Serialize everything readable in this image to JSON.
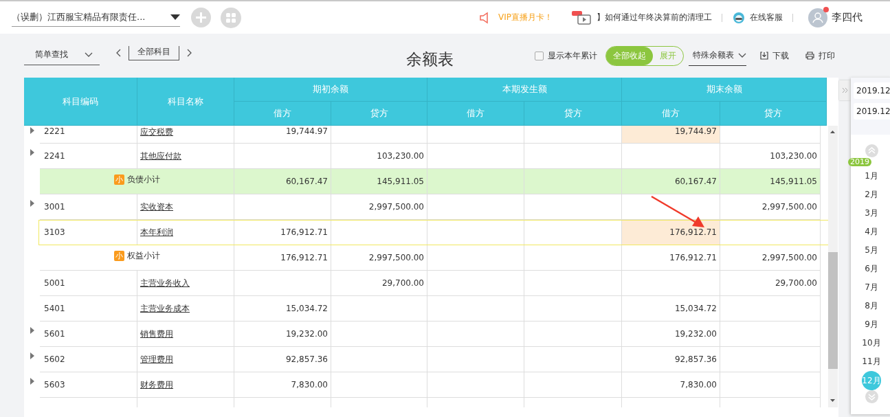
{
  "top_bar": {
    "company": "（误删）江西服宝精品有限责任...",
    "promo": "VIP直播月卡！",
    "news": "】如何通过年终决算前的清理工",
    "support": "在线客服",
    "user": "李四代",
    "user_notification": true
  },
  "toolbar": {
    "search_mode": "简单查找",
    "scope": "全部科目",
    "title": "余额表",
    "cumulative": {
      "label": "显示本年累计",
      "checked": false
    },
    "toggle": [
      {
        "label": "全部收起",
        "selected": true
      },
      {
        "label": "展开",
        "selected": false
      }
    ],
    "report_type": "特殊余额表",
    "download": "下载",
    "print": "打印"
  },
  "table": {
    "columns": [
      {
        "label": "科目编码"
      },
      {
        "label": "科目名称"
      }
    ],
    "groups": [
      {
        "label": "期初余额",
        "columns": [
          "借方",
          "贷方"
        ]
      },
      {
        "label": "本期发生额",
        "columns": [
          "借方",
          "贷方"
        ]
      },
      {
        "label": "期末余额",
        "columns": [
          "借方",
          "贷方"
        ]
      }
    ],
    "rows": [
      {
        "kind": "account",
        "code": "2221",
        "name": "应交税费",
        "expandable": true,
        "selected": false,
        "flagged": true,
        "values": {
          "opening_debit": "19,744.97",
          "closing_debit": "19,744.97"
        }
      },
      {
        "kind": "account",
        "code": "2241",
        "name": "其他应付款",
        "expandable": true,
        "selected": false,
        "flagged": false,
        "values": {
          "opening_credit": "103,230.00",
          "closing_credit": "103,230.00"
        }
      },
      {
        "kind": "subtotal",
        "name": "负债小计",
        "highlighted": true,
        "badge": "小",
        "values": {
          "opening_debit": "60,167.47",
          "opening_credit": "145,911.05",
          "closing_debit": "60,167.47",
          "closing_credit": "145,911.05"
        }
      },
      {
        "kind": "account",
        "code": "3001",
        "name": "实收资本",
        "expandable": true,
        "selected": false,
        "flagged": false,
        "values": {
          "opening_credit": "2,997,500.00",
          "closing_credit": "2,997,500.00"
        }
      },
      {
        "kind": "account",
        "code": "3103",
        "name": "本年利润",
        "expandable": false,
        "selected": true,
        "flagged": true,
        "values": {
          "opening_debit": "176,912.71",
          "closing_debit": "176,912.71"
        }
      },
      {
        "kind": "subtotal",
        "name": "权益小计",
        "highlighted": false,
        "badge": "小",
        "values": {
          "opening_debit": "176,912.71",
          "opening_credit": "2,997,500.00",
          "closing_debit": "176,912.71",
          "closing_credit": "2,997,500.00"
        }
      },
      {
        "kind": "account",
        "code": "5001",
        "name": "主营业务收入",
        "expandable": false,
        "selected": false,
        "flagged": false,
        "values": {
          "opening_credit": "29,700.00",
          "closing_credit": "29,700.00"
        }
      },
      {
        "kind": "account",
        "code": "5401",
        "name": "主营业务成本",
        "expandable": false,
        "selected": false,
        "flagged": false,
        "values": {
          "opening_debit": "15,034.72",
          "closing_debit": "15,034.72"
        }
      },
      {
        "kind": "account",
        "code": "5601",
        "name": "销售费用",
        "expandable": true,
        "selected": false,
        "flagged": false,
        "values": {
          "opening_debit": "19,232.00",
          "closing_debit": "19,232.00"
        }
      },
      {
        "kind": "account",
        "code": "5602",
        "name": "管理费用",
        "expandable": true,
        "selected": false,
        "flagged": false,
        "values": {
          "opening_debit": "92,857.36",
          "closing_debit": "92,857.36"
        }
      },
      {
        "kind": "account",
        "code": "5603",
        "name": "财务费用",
        "expandable": true,
        "selected": false,
        "flagged": false,
        "values": {
          "opening_debit": "7,830.00",
          "closing_debit": "7,830.00"
        }
      }
    ]
  },
  "period_panel": {
    "start": "2019.12",
    "end": "2019.12",
    "year": "2019",
    "months": [
      {
        "label": "1月",
        "selected": false
      },
      {
        "label": "2月",
        "selected": false
      },
      {
        "label": "3月",
        "selected": false
      },
      {
        "label": "4月",
        "selected": false
      },
      {
        "label": "5月",
        "selected": false
      },
      {
        "label": "6月",
        "selected": false
      },
      {
        "label": "7月",
        "selected": false
      },
      {
        "label": "8月",
        "selected": false
      },
      {
        "label": "9月",
        "selected": false
      },
      {
        "label": "10月",
        "selected": false
      },
      {
        "label": "11月",
        "selected": false
      },
      {
        "label": "12月",
        "selected": true
      }
    ]
  }
}
